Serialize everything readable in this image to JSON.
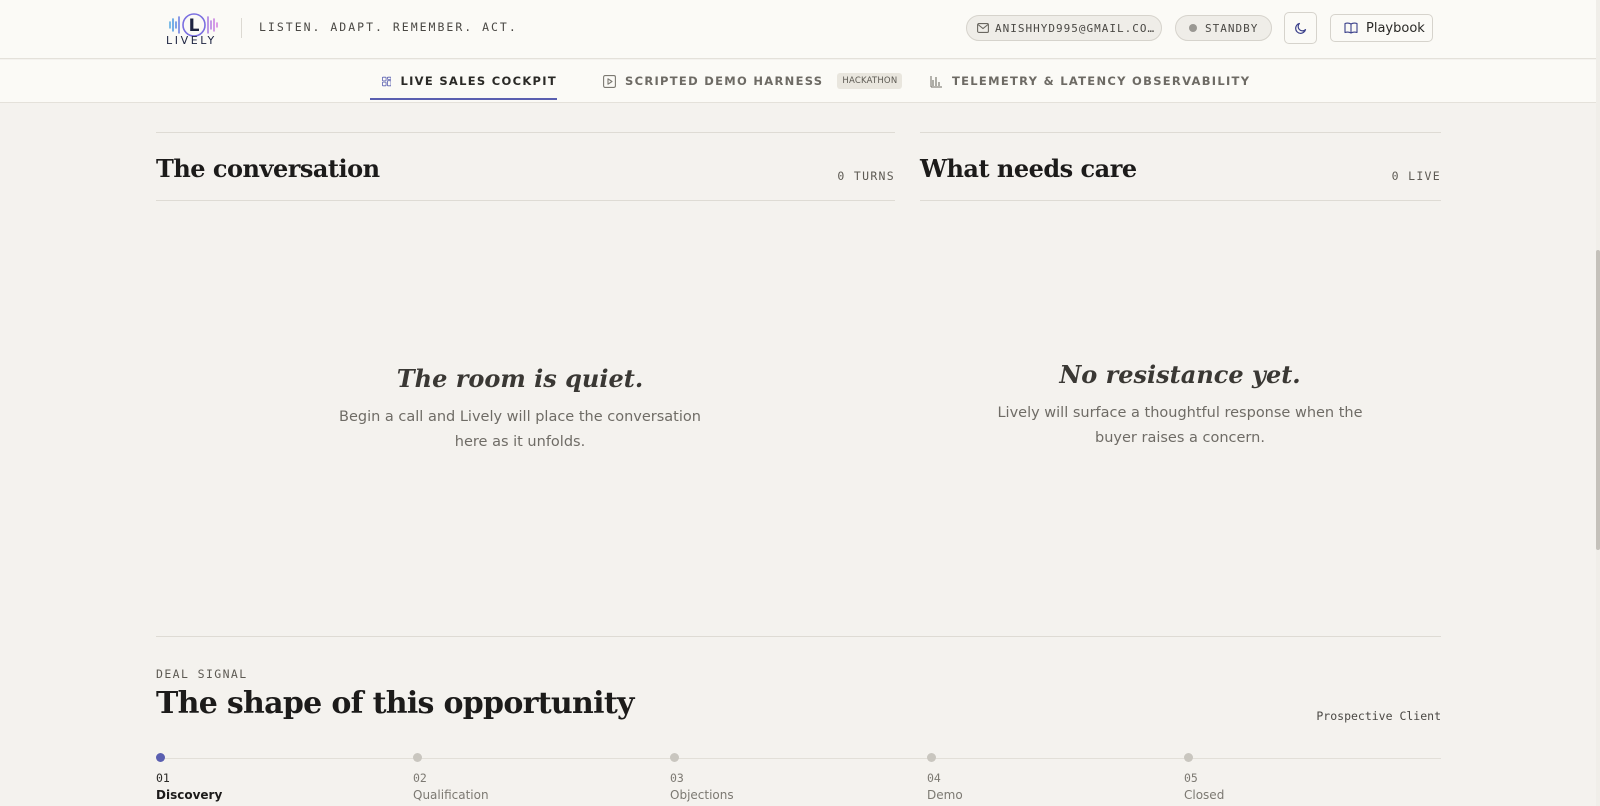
{
  "header": {
    "brand": "LIVELY",
    "tagline": "LISTEN. ADAPT. REMEMBER. ACT.",
    "email": "ANISHHYD995@GMAIL.COM",
    "status": "STANDBY",
    "playbook_label": "Playbook"
  },
  "tabs": [
    {
      "label": "LIVE SALES COCKPIT",
      "active": true
    },
    {
      "label": "SCRIPTED DEMO HARNESS",
      "badge": "HACKATHON"
    },
    {
      "label": "TELEMETRY & LATENCY OBSERVABILITY"
    }
  ],
  "conversation": {
    "title": "The conversation",
    "meta": "0 TURNS",
    "empty_title": "The room is quiet.",
    "empty_desc": "Begin a call and Lively will place the conversation here as it unfolds."
  },
  "care": {
    "title": "What needs care",
    "meta": "0 LIVE",
    "empty_title": "No resistance yet.",
    "empty_desc": "Lively will surface a thoughtful response when the buyer raises a concern."
  },
  "deal": {
    "eyebrow": "DEAL SIGNAL",
    "title": "The shape of this opportunity",
    "client": "Prospective Client",
    "stages": [
      {
        "num": "01",
        "name": "Discovery",
        "active": true
      },
      {
        "num": "02",
        "name": "Qualification"
      },
      {
        "num": "03",
        "name": "Objections"
      },
      {
        "num": "04",
        "name": "Demo"
      },
      {
        "num": "05",
        "name": "Closed"
      }
    ]
  },
  "colors": {
    "accent": "#5a5fb0",
    "background": "#f4f2ee"
  }
}
